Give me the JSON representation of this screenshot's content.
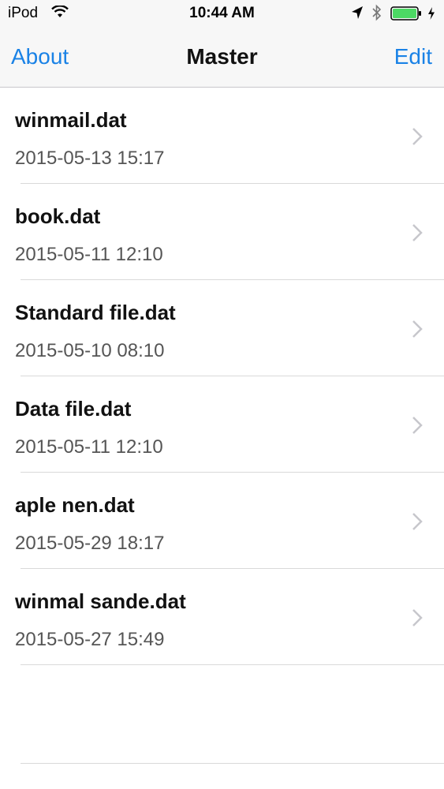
{
  "status_bar": {
    "carrier": "iPod",
    "time": "10:44 AM",
    "icons": [
      "wifi-icon",
      "location-arrow-icon",
      "bluetooth-icon",
      "battery-icon",
      "charging-bolt-icon"
    ],
    "battery_color": "#4cd964"
  },
  "nav": {
    "left_label": "About",
    "title": "Master",
    "right_label": "Edit",
    "accent_color": "#1a82e6"
  },
  "files": [
    {
      "name": "winmail.dat",
      "date": "2015-05-13 15:17"
    },
    {
      "name": "book.dat",
      "date": "2015-05-11 12:10"
    },
    {
      "name": "Standard file.dat",
      "date": "2015-05-10 08:10"
    },
    {
      "name": "Data file.dat",
      "date": "2015-05-11 12:10"
    },
    {
      "name": "aple nen.dat",
      "date": "2015-05-29 18:17"
    },
    {
      "name": "winmal sande.dat",
      "date": "2015-05-27 15:49"
    }
  ]
}
